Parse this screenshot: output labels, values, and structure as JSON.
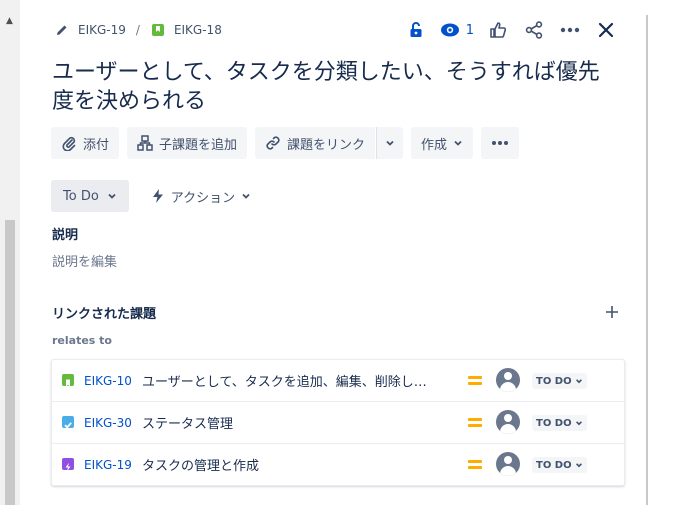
{
  "header": {
    "crumb_parent": "EIKG-19",
    "crumb_sep": "/",
    "crumb_current": "EIKG-18",
    "watch_count": "1"
  },
  "issue": {
    "title": "ユーザーとして、タスクを分類したい、そうすれば優先度を決められる"
  },
  "toolbar": {
    "attach": "添付",
    "add_child": "子課題を追加",
    "link_issue": "課題をリンク",
    "create": "作成"
  },
  "status": {
    "current": "To Do",
    "actions": "アクション"
  },
  "description": {
    "heading": "説明",
    "placeholder": "説明を編集"
  },
  "linked": {
    "heading": "リンクされた課題",
    "relation": "relates to",
    "items": [
      {
        "key": "EIKG-10",
        "summary": "ユーザーとして、タスクを追加、編集、削除し…",
        "type": "story",
        "priority": "medium",
        "status": "TO DO"
      },
      {
        "key": "EIKG-30",
        "summary": "ステータス管理",
        "type": "task",
        "priority": "medium",
        "status": "TO DO"
      },
      {
        "key": "EIKG-19",
        "summary": "タスクの管理と作成",
        "type": "epic",
        "priority": "medium",
        "status": "TO DO"
      }
    ]
  },
  "colors": {
    "story": "#63ba3c",
    "task": "#4bade8",
    "epic": "#904ee2",
    "link": "#0052cc",
    "priority_medium": "#ffab00"
  }
}
